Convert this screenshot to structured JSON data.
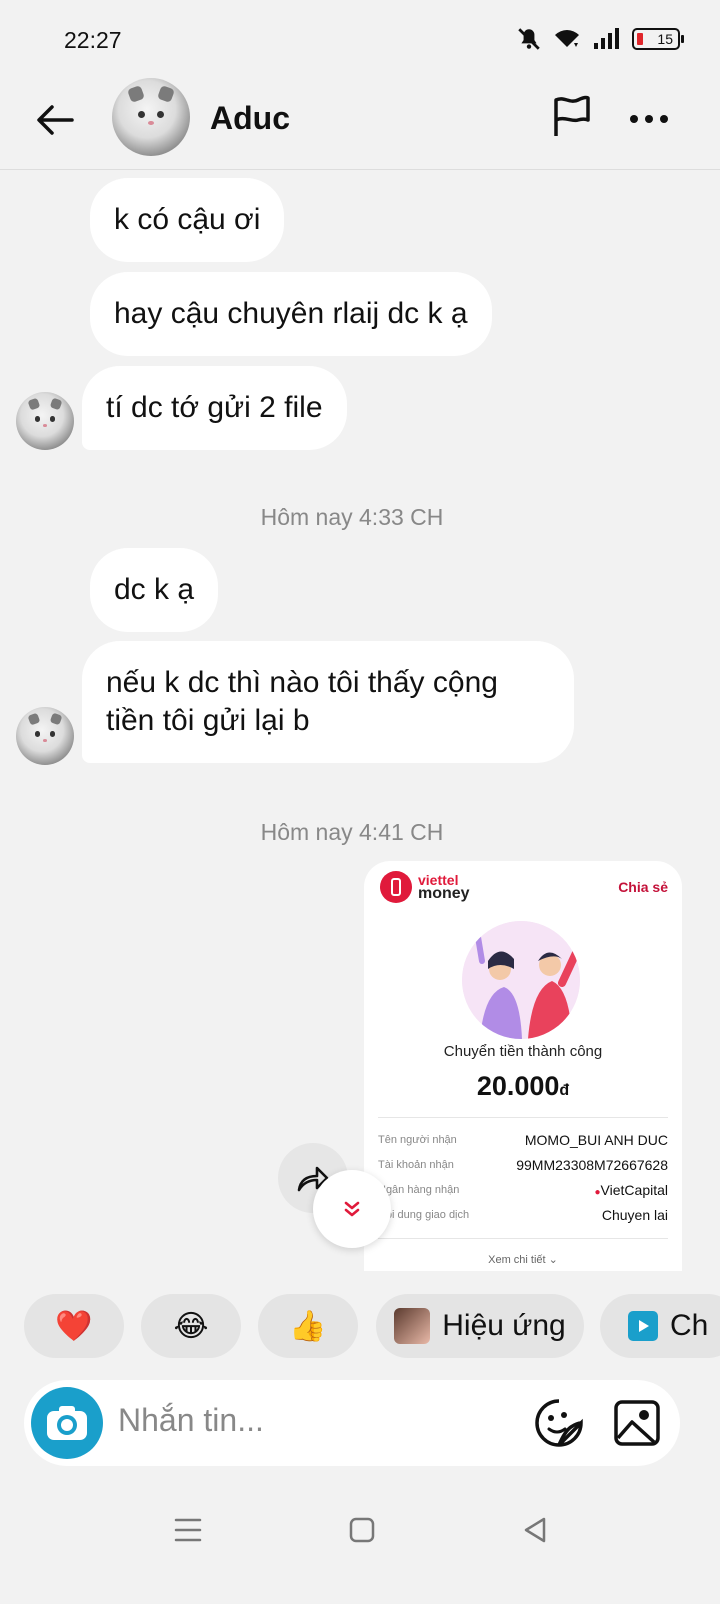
{
  "status_bar": {
    "time": "22:27",
    "battery": "15"
  },
  "header": {
    "contact_name": "Aduc"
  },
  "messages": [
    {
      "text": "k có cậu ơi"
    },
    {
      "text": "hay cậu chuyên rlaij dc k ạ"
    },
    {
      "text": "tí dc tớ gửi 2 file"
    },
    {
      "timestamp": "Hôm nay 4:33 CH"
    },
    {
      "text": "dc k ạ"
    },
    {
      "text_line1": "nếu k dc thì nào tôi thấy cộng",
      "text_line2": "tiền tôi gửi lại b"
    },
    {
      "timestamp": "Hôm nay 4:41 CH"
    }
  ],
  "transfer_card": {
    "brand_line1": "viettel",
    "brand_line2": "money",
    "share_label": "Chia sẻ",
    "status": "Chuyển tiền thành công",
    "amount": "20.000",
    "currency": "đ",
    "rows": [
      {
        "key": "Tên người nhận",
        "value": "MOMO_BUI ANH DUC"
      },
      {
        "key": "Tài khoản nhận",
        "value": "99MM23308M72667628"
      },
      {
        "key": "Ngân hàng nhận",
        "value": "VietCapital"
      },
      {
        "key": "Nội dung giao dịch",
        "value": "Chuyen lai"
      }
    ],
    "details_link": "Xem chi tiết"
  },
  "reactions": [
    {
      "emoji": "❤️",
      "icon": "heart-icon"
    },
    {
      "emoji": "😂",
      "icon": "laughing-icon"
    },
    {
      "emoji": "👍",
      "icon": "thumbs-up-icon"
    },
    {
      "label": "Hiệu ứng",
      "icon": "effects-avatar"
    },
    {
      "label": "Ch",
      "icon": "play-icon"
    }
  ],
  "composer": {
    "placeholder": "Nhắn tin..."
  },
  "colors": {
    "accent": "#1a9fcb",
    "viettel_red": "#e01a3b",
    "background": "#f2f2f2"
  }
}
